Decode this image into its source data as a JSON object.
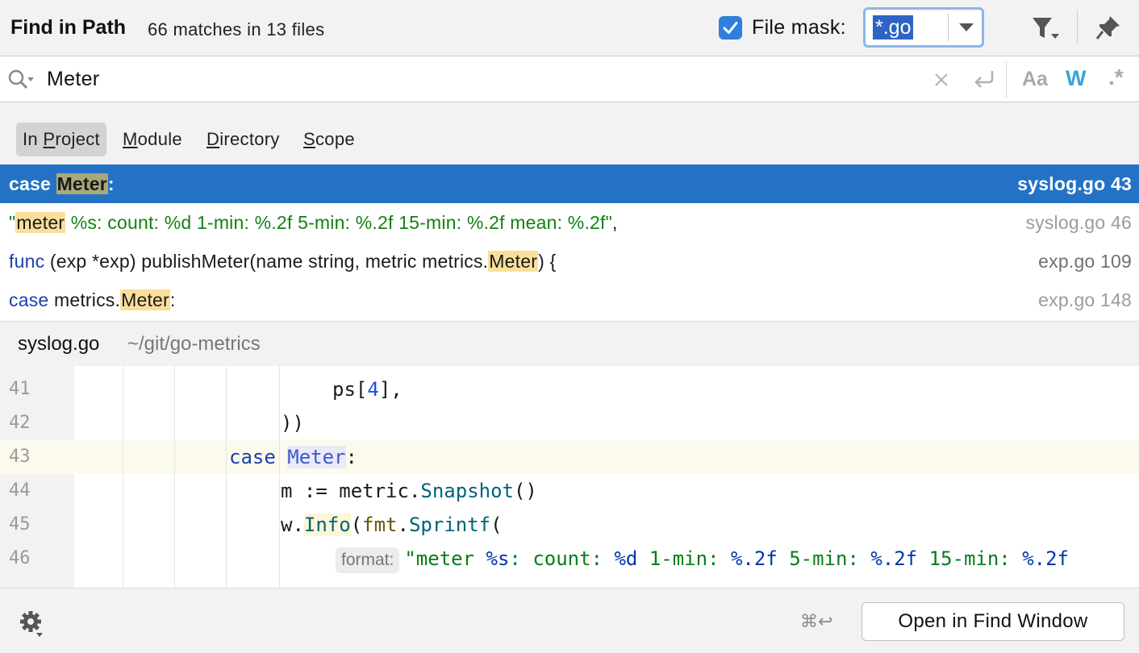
{
  "header": {
    "title": "Find in Path",
    "match_count": "66 matches in 13 files",
    "file_mask_checked": true,
    "file_mask_label": "File mask:",
    "file_mask_value": "*.go"
  },
  "search": {
    "query": "Meter",
    "options": {
      "match_case": "Aa",
      "words": "W",
      "regex": ".*"
    },
    "words_active": true
  },
  "scope": {
    "tabs": [
      {
        "pre": "In ",
        "ul": "P",
        "post": "roject",
        "active": true
      },
      {
        "pre": "",
        "ul": "M",
        "post": "odule",
        "active": false
      },
      {
        "pre": "",
        "ul": "D",
        "post": "irectory",
        "active": false
      },
      {
        "pre": "",
        "ul": "S",
        "post": "cope",
        "active": false
      }
    ]
  },
  "results": [
    {
      "parts": [
        {
          "t": "case "
        },
        {
          "t": "Meter",
          "c": "hl-sel"
        },
        {
          "t": ":"
        }
      ],
      "file": "syslog.go 43",
      "selected": true
    },
    {
      "parts": [
        {
          "t": "\"",
          "c": "str"
        },
        {
          "t": "meter",
          "c": "hl"
        },
        {
          "t": " %s: count: %d 1-min: %.2f 5-min: %.2f 15-min: %.2f mean: %.2f\"",
          "c": "str"
        },
        {
          "t": ","
        }
      ],
      "file": "syslog.go 46",
      "selected": false
    },
    {
      "parts": [
        {
          "t": "func",
          "c": "kw"
        },
        {
          "t": " (exp *exp) publishMeter(name string, metric metrics."
        },
        {
          "t": "Meter",
          "c": "hl"
        },
        {
          "t": ") {"
        }
      ],
      "file": "exp.go 109",
      "selected": false
    },
    {
      "parts": [
        {
          "t": "case",
          "c": "kw"
        },
        {
          "t": " metrics."
        },
        {
          "t": "Meter",
          "c": "hl"
        },
        {
          "t": ":"
        }
      ],
      "file": "exp.go 148",
      "selected": false
    }
  ],
  "preview": {
    "file": "syslog.go",
    "path": "~/git/go-metrics",
    "lines": [
      {
        "n": "41",
        "indent": 412,
        "parts": [
          {
            "t": "ps["
          },
          {
            "t": "4",
            "c": "c-num"
          },
          {
            "t": "],"
          }
        ]
      },
      {
        "n": "42",
        "indent": 348,
        "parts": [
          {
            "t": "))"
          }
        ]
      },
      {
        "n": "43",
        "indent": 284,
        "current": true,
        "parts": [
          {
            "t": "case",
            "c": "c-kw"
          },
          {
            "t": " "
          },
          {
            "t": "Meter",
            "c": "c-match"
          },
          {
            "t": ":"
          }
        ]
      },
      {
        "n": "44",
        "indent": 348,
        "parts": [
          {
            "t": "m := metric."
          },
          {
            "t": "Snapshot",
            "c": "c-call"
          },
          {
            "t": "()"
          }
        ]
      },
      {
        "n": "45",
        "indent": 348,
        "parts": [
          {
            "t": "w."
          },
          {
            "t": "Info",
            "c": "c-info"
          },
          {
            "t": "("
          },
          {
            "t": "fmt",
            "c": "c-pkg"
          },
          {
            "t": "."
          },
          {
            "t": "Sprintf",
            "c": "c-call"
          },
          {
            "t": "("
          }
        ]
      },
      {
        "n": "46",
        "indent": 416,
        "parts": [
          {
            "t": "format:",
            "c": "hint"
          },
          {
            "t": "\"meter ",
            "c": "c-str"
          },
          {
            "t": "%s",
            "c": "c-fmt"
          },
          {
            "t": ": count: ",
            "c": "c-str"
          },
          {
            "t": "%d",
            "c": "c-fmt"
          },
          {
            "t": " 1-min: ",
            "c": "c-str"
          },
          {
            "t": "%.2f",
            "c": "c-fmt"
          },
          {
            "t": " 5-min: ",
            "c": "c-str"
          },
          {
            "t": "%.2f",
            "c": "c-fmt"
          },
          {
            "t": " 15-min: ",
            "c": "c-str"
          },
          {
            "t": "%.2f",
            "c": "c-fmt"
          }
        ]
      }
    ]
  },
  "footer": {
    "shortcut": "⌘↩",
    "open_button": "Open in Find Window"
  },
  "colors": {
    "selection": "#2472c5",
    "accent": "#2f7fdc",
    "match_highlight": "#f9df9a"
  }
}
